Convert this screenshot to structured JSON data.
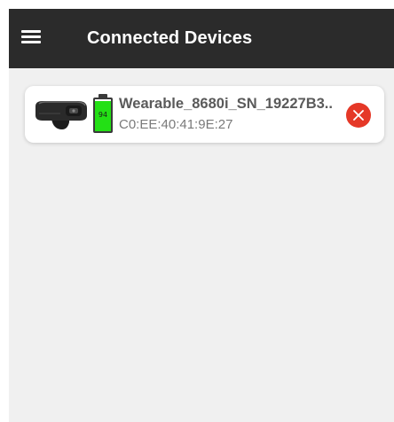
{
  "app_bar": {
    "title": "Connected Devices",
    "menu_icon": "hamburger-menu-icon"
  },
  "devices": [
    {
      "name": "Wearable_8680i_SN_19227B3..",
      "mac": "C0:EE:40:41:9E:27",
      "battery_percent": "94",
      "battery_level": 0.94,
      "image_icon": "wearable-scanner-icon",
      "disconnect_icon": "close-circle-icon"
    }
  ],
  "colors": {
    "app_bar": "#2b2b2b",
    "background": "#f0f0f0",
    "battery_fill": "#23e015",
    "disconnect": "#e53827"
  }
}
